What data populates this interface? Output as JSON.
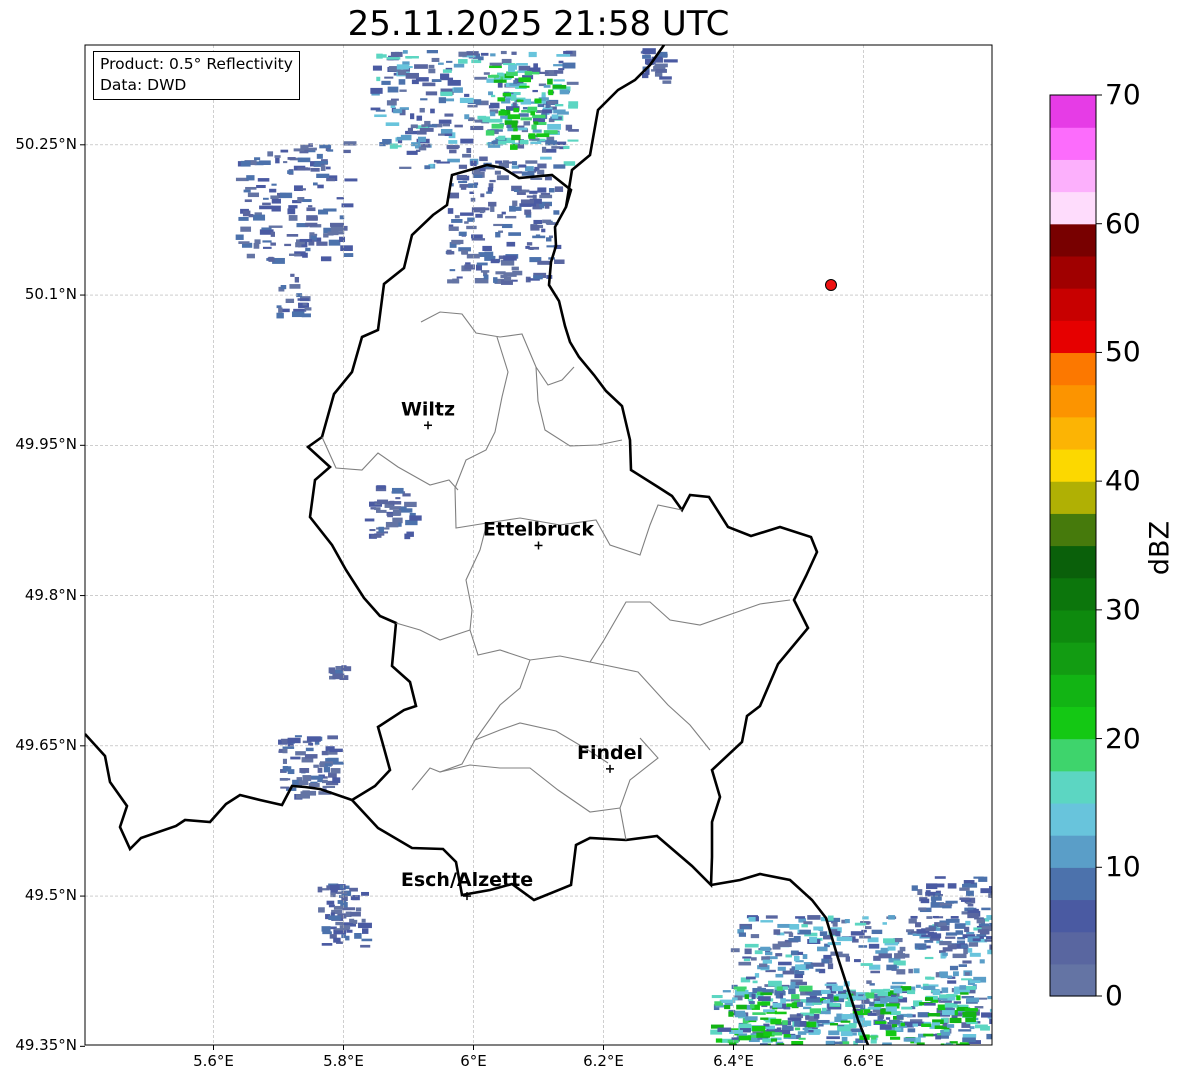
{
  "title": "25.11.2025 21:58 UTC",
  "info": {
    "product": "Product: 0.5° Reflectivity",
    "data": "Data: DWD"
  },
  "axes": {
    "lat_labels": [
      "50.25°N",
      "50.1°N",
      "49.95°N",
      "49.8°N",
      "49.65°N",
      "49.5°N",
      "49.35°N"
    ],
    "lon_labels": [
      "5.6°E",
      "5.8°E",
      "6°E",
      "6.2°E",
      "6.4°E",
      "6.6°E"
    ],
    "grid": true
  },
  "cities": [
    {
      "name": "Wiltz",
      "lon": 5.93,
      "lat": 49.97
    },
    {
      "name": "Ettelbruck",
      "lon": 6.1,
      "lat": 49.85
    },
    {
      "name": "Findel",
      "lon": 6.21,
      "lat": 49.627
    },
    {
      "name": "Esch/Alzette",
      "lon": 5.99,
      "lat": 49.5
    }
  ],
  "marker": {
    "lon": 6.55,
    "lat": 50.11,
    "color": "#ee1111"
  },
  "colorbar": {
    "label": "dBZ",
    "tick_labels": [
      "0",
      "10",
      "20",
      "30",
      "40",
      "50",
      "60",
      "70"
    ],
    "range": [
      0,
      70
    ],
    "colors": [
      "#6474a4",
      "#5966a0",
      "#4a5aa2",
      "#4c72ac",
      "#5a9ec8",
      "#68c4dc",
      "#5cd6c2",
      "#3ed46c",
      "#14c814",
      "#12b414",
      "#129c12",
      "#0e8a0e",
      "#0c760c",
      "#0a600a",
      "#467a0c",
      "#b0b004",
      "#fcd800",
      "#fcb404",
      "#fc9400",
      "#fc7800",
      "#e60000",
      "#c80000",
      "#a00000",
      "#780000",
      "#fedcfc",
      "#fcb0fc",
      "#fc6cfc",
      "#e63ce6"
    ]
  }
}
